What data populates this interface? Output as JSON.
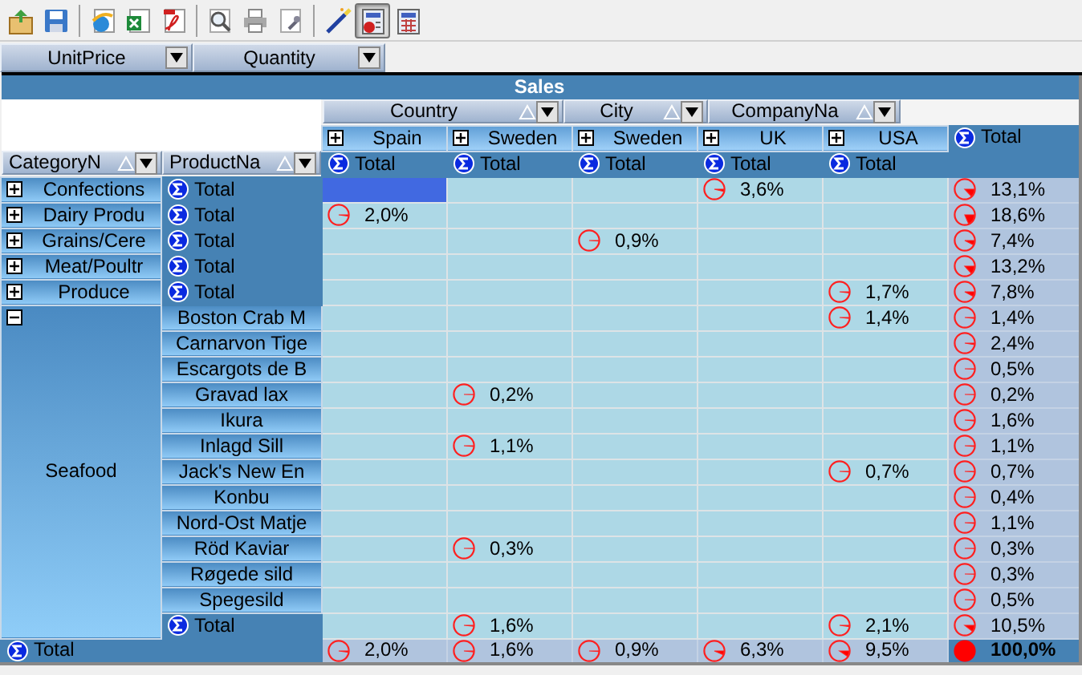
{
  "toolbar": [
    {
      "kind": "open",
      "active": false
    },
    {
      "kind": "save",
      "active": false
    },
    {
      "kind": "separator"
    },
    {
      "kind": "browser",
      "active": false
    },
    {
      "kind": "excel",
      "active": false
    },
    {
      "kind": "pdf",
      "active": false
    },
    {
      "kind": "separator"
    },
    {
      "kind": "preview",
      "active": false
    },
    {
      "kind": "print",
      "active": false
    },
    {
      "kind": "page-setup",
      "active": false
    },
    {
      "kind": "separator"
    },
    {
      "kind": "wand",
      "active": false
    },
    {
      "kind": "report",
      "active": true
    },
    {
      "kind": "grid",
      "active": false
    }
  ],
  "filter_fields": [
    "UnitPrice",
    "Quantity"
  ],
  "title": "Sales",
  "column_fields": [
    "Country",
    "City",
    "CompanyNa"
  ],
  "row_fields": [
    "CategoryN",
    "ProductNa"
  ],
  "columns": [
    {
      "label": "Spain",
      "expanded": false,
      "subtotal": "Total"
    },
    {
      "label": "Sweden",
      "expanded": false,
      "subtotal": "Total"
    },
    {
      "label": "Sweden",
      "expanded": false,
      "subtotal": "Total"
    },
    {
      "label": "UK",
      "expanded": false,
      "subtotal": "Total"
    },
    {
      "label": "USA",
      "expanded": false,
      "subtotal": "Total"
    }
  ],
  "total_column": "Total",
  "categories": [
    {
      "name": "Confections",
      "expanded": false,
      "lines": [
        {
          "kind": "total",
          "label": "Total",
          "cells": [
            {
              "selected": true
            },
            {
              "selected": false
            },
            {
              "selected": false
            },
            {
              "text": "3,6%",
              "level": 0.036,
              "selected": false
            },
            {
              "selected": false
            },
            {
              "text": "13,1%",
              "level": 0.131,
              "selected": false
            }
          ]
        }
      ]
    },
    {
      "name": "Dairy Produ",
      "expanded": false,
      "lines": [
        {
          "kind": "total",
          "label": "Total",
          "cells": [
            {
              "text": "2,0%",
              "level": 0.02,
              "selected": false
            },
            {
              "selected": false
            },
            {
              "selected": false
            },
            {
              "selected": false
            },
            {
              "selected": false
            },
            {
              "text": "18,6%",
              "level": 0.186,
              "selected": false
            }
          ]
        }
      ]
    },
    {
      "name": "Grains/Cere",
      "expanded": false,
      "lines": [
        {
          "kind": "total",
          "label": "Total",
          "cells": [
            {
              "selected": false
            },
            {
              "selected": false
            },
            {
              "text": "0,9%",
              "level": 0.009,
              "selected": false
            },
            {
              "selected": false
            },
            {
              "selected": false
            },
            {
              "text": "7,4%",
              "level": 0.074,
              "selected": false
            }
          ]
        }
      ]
    },
    {
      "name": "Meat/Poultr",
      "expanded": false,
      "lines": [
        {
          "kind": "total",
          "label": "Total",
          "cells": [
            {
              "selected": false
            },
            {
              "selected": false
            },
            {
              "selected": false
            },
            {
              "selected": false
            },
            {
              "selected": false
            },
            {
              "text": "13,2%",
              "level": 0.132,
              "selected": false
            }
          ]
        }
      ]
    },
    {
      "name": "Produce",
      "expanded": false,
      "lines": [
        {
          "kind": "total",
          "label": "Total",
          "cells": [
            {
              "selected": false
            },
            {
              "selected": false
            },
            {
              "selected": false
            },
            {
              "selected": false
            },
            {
              "text": "1,7%",
              "level": 0.017,
              "selected": false
            },
            {
              "text": "7,8%",
              "level": 0.078,
              "selected": false
            }
          ]
        }
      ]
    },
    {
      "name": "Seafood",
      "expanded": true,
      "lines": [
        {
          "kind": "item",
          "label": "Boston Crab M",
          "cells": [
            {
              "selected": false
            },
            {
              "selected": false
            },
            {
              "selected": false
            },
            {
              "selected": false
            },
            {
              "text": "1,4%",
              "level": 0.014,
              "selected": false
            },
            {
              "text": "1,4%",
              "level": 0.014,
              "selected": false
            }
          ]
        },
        {
          "kind": "item",
          "label": "Carnarvon Tige",
          "cells": [
            {
              "selected": false
            },
            {
              "selected": false
            },
            {
              "selected": false
            },
            {
              "selected": false
            },
            {
              "selected": false
            },
            {
              "text": "2,4%",
              "level": 0.024,
              "selected": false
            }
          ]
        },
        {
          "kind": "item",
          "label": "Escargots de B",
          "cells": [
            {
              "selected": false
            },
            {
              "selected": false
            },
            {
              "selected": false
            },
            {
              "selected": false
            },
            {
              "selected": false
            },
            {
              "text": "0,5%",
              "level": 0.005,
              "selected": false
            }
          ]
        },
        {
          "kind": "item",
          "label": "Gravad lax",
          "cells": [
            {
              "selected": false
            },
            {
              "text": "0,2%",
              "level": 0.002,
              "selected": false
            },
            {
              "selected": false
            },
            {
              "selected": false
            },
            {
              "selected": false
            },
            {
              "text": "0,2%",
              "level": 0.002,
              "selected": false
            }
          ]
        },
        {
          "kind": "item",
          "label": "Ikura",
          "cells": [
            {
              "selected": false
            },
            {
              "selected": false
            },
            {
              "selected": false
            },
            {
              "selected": false
            },
            {
              "selected": false
            },
            {
              "text": "1,6%",
              "level": 0.016,
              "selected": false
            }
          ]
        },
        {
          "kind": "item",
          "label": "Inlagd Sill",
          "cells": [
            {
              "selected": false
            },
            {
              "text": "1,1%",
              "level": 0.011,
              "selected": false
            },
            {
              "selected": false
            },
            {
              "selected": false
            },
            {
              "selected": false
            },
            {
              "text": "1,1%",
              "level": 0.011,
              "selected": false
            }
          ]
        },
        {
          "kind": "item",
          "label": "Jack's New En",
          "cells": [
            {
              "selected": false
            },
            {
              "selected": false
            },
            {
              "selected": false
            },
            {
              "selected": false
            },
            {
              "text": "0,7%",
              "level": 0.007,
              "selected": false
            },
            {
              "text": "0,7%",
              "level": 0.007,
              "selected": false
            }
          ]
        },
        {
          "kind": "item",
          "label": "Konbu",
          "cells": [
            {
              "selected": false
            },
            {
              "selected": false
            },
            {
              "selected": false
            },
            {
              "selected": false
            },
            {
              "selected": false
            },
            {
              "text": "0,4%",
              "level": 0.004,
              "selected": false
            }
          ]
        },
        {
          "kind": "item",
          "label": "Nord-Ost Matje",
          "cells": [
            {
              "selected": false
            },
            {
              "selected": false
            },
            {
              "selected": false
            },
            {
              "selected": false
            },
            {
              "selected": false
            },
            {
              "text": "1,1%",
              "level": 0.011,
              "selected": false
            }
          ]
        },
        {
          "kind": "item",
          "label": "Röd Kaviar",
          "cells": [
            {
              "selected": false
            },
            {
              "text": "0,3%",
              "level": 0.003,
              "selected": false
            },
            {
              "selected": false
            },
            {
              "selected": false
            },
            {
              "selected": false
            },
            {
              "text": "0,3%",
              "level": 0.003,
              "selected": false
            }
          ]
        },
        {
          "kind": "item",
          "label": "Røgede sild",
          "cells": [
            {
              "selected": false
            },
            {
              "selected": false
            },
            {
              "selected": false
            },
            {
              "selected": false
            },
            {
              "selected": false
            },
            {
              "text": "0,3%",
              "level": 0.003,
              "selected": false
            }
          ]
        },
        {
          "kind": "item",
          "label": "Spegesild",
          "cells": [
            {
              "selected": false
            },
            {
              "selected": false
            },
            {
              "selected": false
            },
            {
              "selected": false
            },
            {
              "selected": false
            },
            {
              "text": "0,5%",
              "level": 0.005,
              "selected": false
            }
          ]
        },
        {
          "kind": "total",
          "label": "Total",
          "cells": [
            {
              "selected": false
            },
            {
              "text": "1,6%",
              "level": 0.016,
              "selected": false
            },
            {
              "selected": false
            },
            {
              "selected": false
            },
            {
              "text": "2,1%",
              "level": 0.021,
              "selected": false
            },
            {
              "text": "10,5%",
              "level": 0.105,
              "selected": false
            }
          ]
        }
      ]
    }
  ],
  "grand_total": {
    "label": "Total",
    "cells": [
      {
        "text": "2,0%",
        "level": 0.02,
        "selected": false
      },
      {
        "text": "1,6%",
        "level": 0.016,
        "selected": false
      },
      {
        "text": "0,9%",
        "level": 0.009,
        "selected": false
      },
      {
        "text": "6,3%",
        "level": 0.063,
        "selected": false
      },
      {
        "text": "9,5%",
        "level": 0.095,
        "selected": false
      },
      {
        "text": "100,0%",
        "kind": "full-pie",
        "selected": false
      }
    ]
  }
}
